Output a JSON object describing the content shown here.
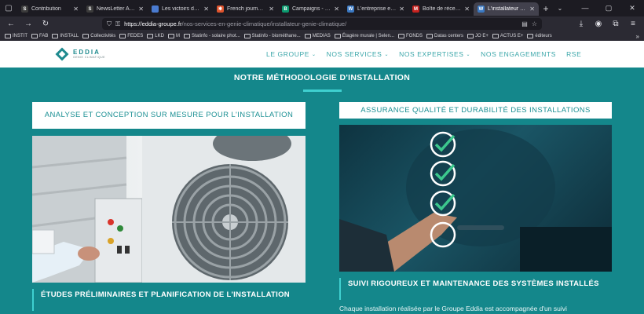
{
  "browser": {
    "tabs": [
      {
        "title": "Contribution",
        "favicon_color": "#3b3b3b",
        "favicon_glyph": "S"
      },
      {
        "title": "NewsLetter App",
        "favicon_color": "#3b3b3b",
        "favicon_glyph": "S"
      },
      {
        "title": "Les victoirs du géi",
        "favicon_color": "#4a7bd0",
        "favicon_glyph": ""
      },
      {
        "title": "French journalistic",
        "favicon_color": "#e0542d",
        "favicon_glyph": "✱"
      },
      {
        "title": "Campaigns - Brevo",
        "favicon_color": "#0b996e",
        "favicon_glyph": "B"
      },
      {
        "title": "L'entreprise en gé",
        "favicon_color": "#3a78c2",
        "favicon_glyph": "W"
      },
      {
        "title": "Boîte de réception",
        "favicon_color": "#c5221f",
        "favicon_glyph": "M"
      },
      {
        "title": "L'installateur de vi",
        "favicon_color": "#3a78c2",
        "favicon_glyph": "W"
      }
    ],
    "active_tab": 7,
    "url_domain": "https://eddia-groupe.fr",
    "url_path": "/nos-services-en-genie-climatique/installateur-genie-climatique/",
    "bookmarks": [
      "INSTIT",
      "FAB",
      "INSTALL",
      "Collectivités",
      "FEDES",
      "LKD",
      "M",
      "Statinfo - solaire phot...",
      "Statinfo - biométhane...",
      "MEDIAS",
      "Étagère murale | Selen...",
      "FONDS",
      "Datas centers",
      "JO E+",
      "ACTUS E+",
      "éditeurs"
    ]
  },
  "site": {
    "logo_name": "EDDIA",
    "logo_sub": "GENIE CLIMATIQUE",
    "nav": [
      {
        "label": "LE GROUPE",
        "dropdown": true
      },
      {
        "label": "NOS SERVICES",
        "dropdown": true
      },
      {
        "label": "NOS EXPERTISES",
        "dropdown": true
      },
      {
        "label": "NOS ENGAGEMENTS",
        "dropdown": false
      },
      {
        "label": "RSE",
        "dropdown": false
      }
    ]
  },
  "section": {
    "title": "NOTRE MÉTHODOLOGIE D'INSTALLATION",
    "left_card": {
      "label": "ANALYSE ET CONCEPTION SUR MESURE POUR L'INSTALLATION",
      "subheading": "ÉTUDES PRÉLIMINAIRES ET PLANIFICATION DE L'INSTALLATION"
    },
    "right_card": {
      "label": "ASSURANCE QUALITÉ ET DURABILITÉ DES INSTALLATIONS",
      "subheading": "SUIVI RIGOUREUX ET MAINTENANCE DES SYSTÈMES INSTALLÉS",
      "paragraph": "Chaque installation réalisée par le Groupe Eddia est accompagnée d'un suivi"
    }
  },
  "colors": {
    "teal_bg": "#14878b",
    "accent": "#3fd0d0",
    "brand": "#1e8a8e"
  }
}
